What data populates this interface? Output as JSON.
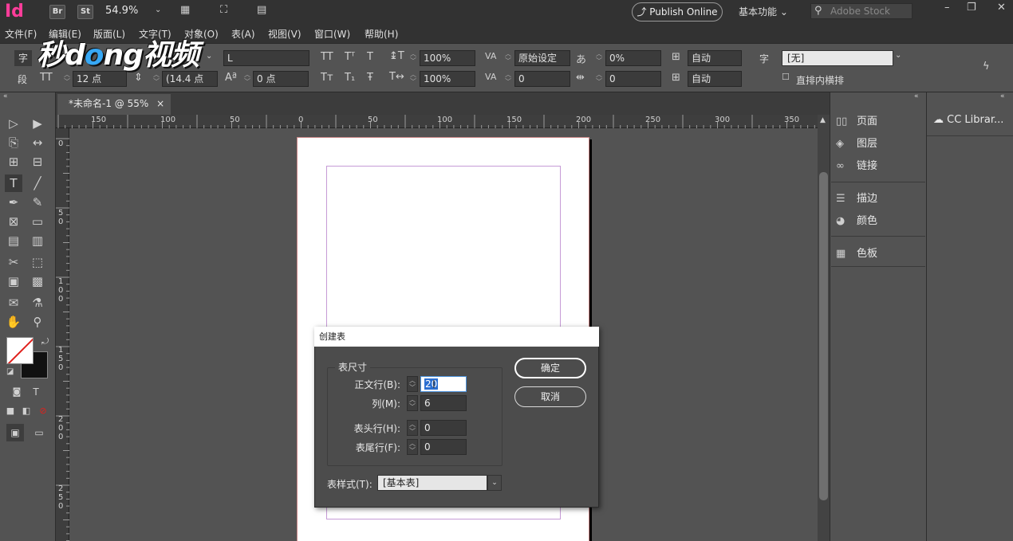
{
  "appbar": {
    "app_logo": "Id",
    "bridge_btn": "Br",
    "stock_btn": "St",
    "zoom": "54.9%",
    "publish": "Publish Online",
    "workspace": "基本功能",
    "search_placeholder": "Adobe Stock"
  },
  "menu": [
    "文件(F)",
    "编辑(E)",
    "版面(L)",
    "文字(T)",
    "对象(O)",
    "表(A)",
    "视图(V)",
    "窗口(W)",
    "帮助(H)"
  ],
  "control": {
    "font_style": "L",
    "font_size": "12 点",
    "leading": "(14.4 点",
    "baseline_shift": "0 点",
    "vscale": "100%",
    "hscale": "100%",
    "kerning": "原始设定",
    "tracking": "0",
    "tsume": "0%",
    "aki1": "0",
    "grid1": "自动",
    "grid2": "自动",
    "char_style": "[无]",
    "char_label": "字",
    "para_label": "段",
    "tate_chu_yoko": "直排内横排"
  },
  "doc_tab": {
    "title": "*未命名-1 @ 55%"
  },
  "hruler": [
    "150",
    "100",
    "50",
    "0",
    "50",
    "100",
    "150",
    "200",
    "250",
    "300",
    "350"
  ],
  "vruler": [
    "0",
    "5\n0",
    "1\n0\n0",
    "1\n5\n0",
    "2\n0\n0",
    "2\n5\n0"
  ],
  "panels": {
    "pages": "页面",
    "layers": "图层",
    "links": "链接",
    "stroke": "描边",
    "color": "颜色",
    "swatches": "色板",
    "cc_libraries": "CC Librar..."
  },
  "dialog": {
    "title": "创建表",
    "group_title": "表尺寸",
    "body_rows_label": "正文行(B):",
    "body_rows_value": "20",
    "columns_label": "列(M):",
    "columns_value": "6",
    "header_rows_label": "表头行(H):",
    "header_rows_value": "0",
    "footer_rows_label": "表尾行(F):",
    "footer_rows_value": "0",
    "table_style_label": "表样式(T):",
    "table_style_value": "[基本表]",
    "ok": "确定",
    "cancel": "取消"
  },
  "watermark": {
    "part1": "秒d",
    "part2": "o",
    "part3": "ng视频"
  }
}
